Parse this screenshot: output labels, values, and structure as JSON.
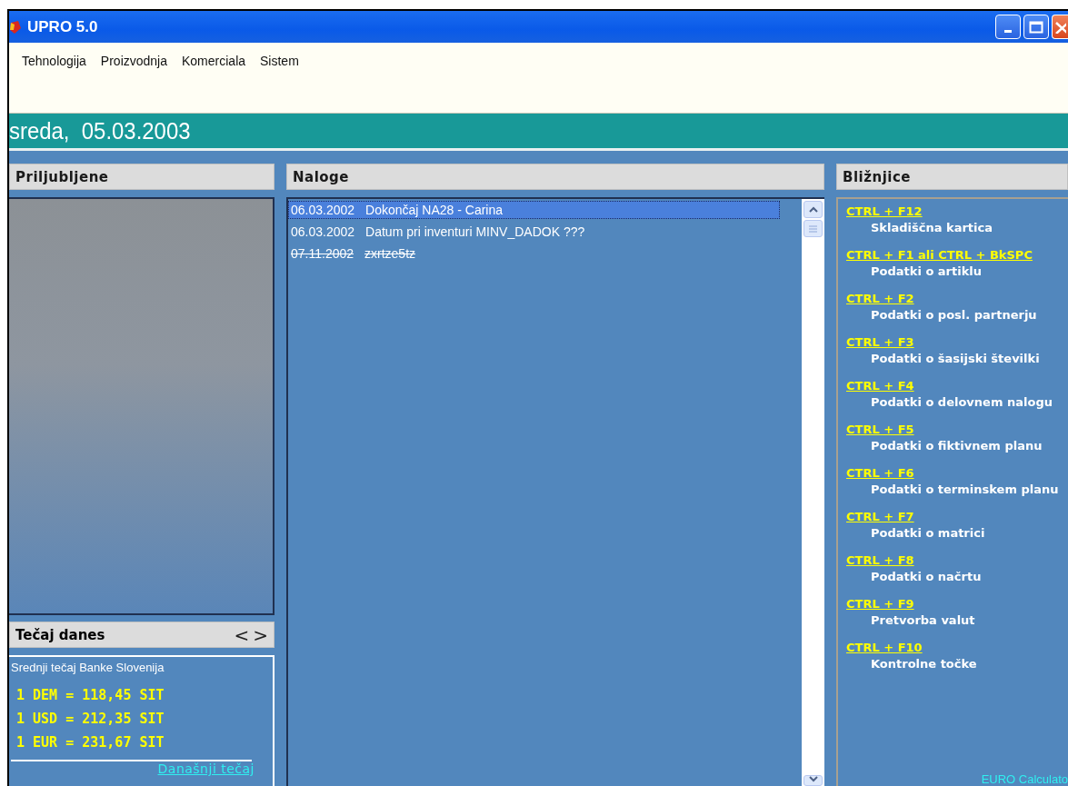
{
  "window": {
    "title": "UPRO 5.0"
  },
  "menu": [
    "Tehnologija",
    "Proizvodnja",
    "Komerciala",
    "Sistem"
  ],
  "date_bar": "sreda,  05.03.2003",
  "favorites": {
    "title": "Priljubljene"
  },
  "rates": {
    "title": "Tečaj danes",
    "prev": "<",
    "next": ">",
    "source": "Srednji tečaj Banke Slovenija",
    "lines": [
      "1 DEM = 118,45 SIT",
      "1 USD = 212,35 SIT",
      "1 EUR = 231,67 SIT"
    ],
    "link": "Današnji tečaj"
  },
  "orders": {
    "title": "Naloge",
    "items": [
      {
        "date": "06.03.2002",
        "text": "Dokončaj NA28 - Carina",
        "selected": true,
        "done": false
      },
      {
        "date": "06.03.2002",
        "text": "Datum pri inventuri MINV_DADOK ???",
        "selected": false,
        "done": false
      },
      {
        "date": "07.11.2002",
        "text": "zxrtze5tz",
        "selected": false,
        "done": true
      }
    ]
  },
  "shortcuts": {
    "title": "Bližnjice",
    "items": [
      {
        "keys": "CTRL + F12",
        "label": "Skladiščna kartica"
      },
      {
        "keys": "CTRL + F1 ali CTRL + BkSPC",
        "label": "Podatki o artiklu"
      },
      {
        "keys": "CTRL + F2",
        "label": "Podatki o posl. partnerju"
      },
      {
        "keys": "CTRL + F3",
        "label": "Podatki o šasijski številki"
      },
      {
        "keys": "CTRL + F4",
        "label": "Podatki o delovnem nalogu"
      },
      {
        "keys": "CTRL + F5",
        "label": "Podatki o fiktivnem planu"
      },
      {
        "keys": "CTRL + F6",
        "label": "Podatki o terminskem planu"
      },
      {
        "keys": "CTRL + F7",
        "label": "Podatki o matrici"
      },
      {
        "keys": "CTRL + F8",
        "label": "Podatki o načrtu"
      },
      {
        "keys": "CTRL + F9",
        "label": "Pretvorba valut"
      },
      {
        "keys": "CTRL + F10",
        "label": "Kontrolne točke"
      }
    ],
    "calculator_link": "EURO Calculato"
  }
}
